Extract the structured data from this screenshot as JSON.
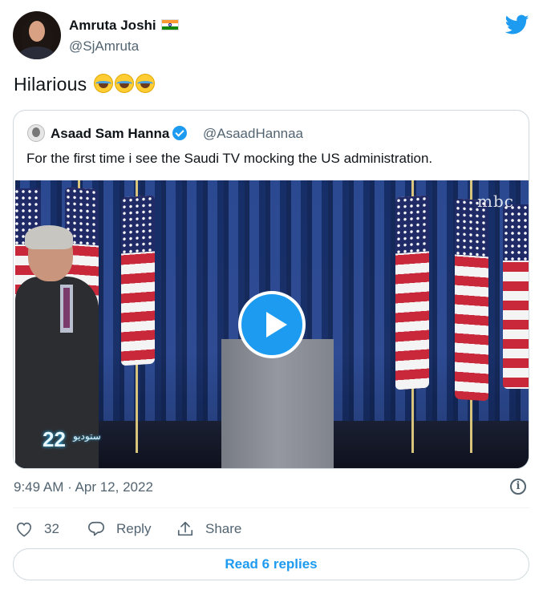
{
  "author": {
    "name": "Amruta Joshi",
    "handle": "@SjAmruta",
    "flag_icon": "india-flag-emoji"
  },
  "tweet": {
    "text": "Hilarious",
    "emojis": [
      "face-with-tears-of-joy",
      "face-with-tears-of-joy",
      "face-with-tears-of-joy"
    ],
    "timestamp": "9:49 AM · Apr 12, 2022"
  },
  "quoted": {
    "name": "Asaad Sam Hanna",
    "handle": "@AsaadHannaa",
    "verified": true,
    "text": "For the first time i see the Saudi TV mocking the US administration.",
    "video": {
      "channel_logo": "mbc",
      "studio_badge": "22",
      "studio_badge_sub": "ستوديو"
    }
  },
  "actions": {
    "like_count": "32",
    "reply_label": "Reply",
    "share_label": "Share"
  },
  "read_replies_label": "Read 6 replies",
  "colors": {
    "accent": "#1d9bf0",
    "secondary_text": "#536471",
    "border": "#cfd9de"
  }
}
